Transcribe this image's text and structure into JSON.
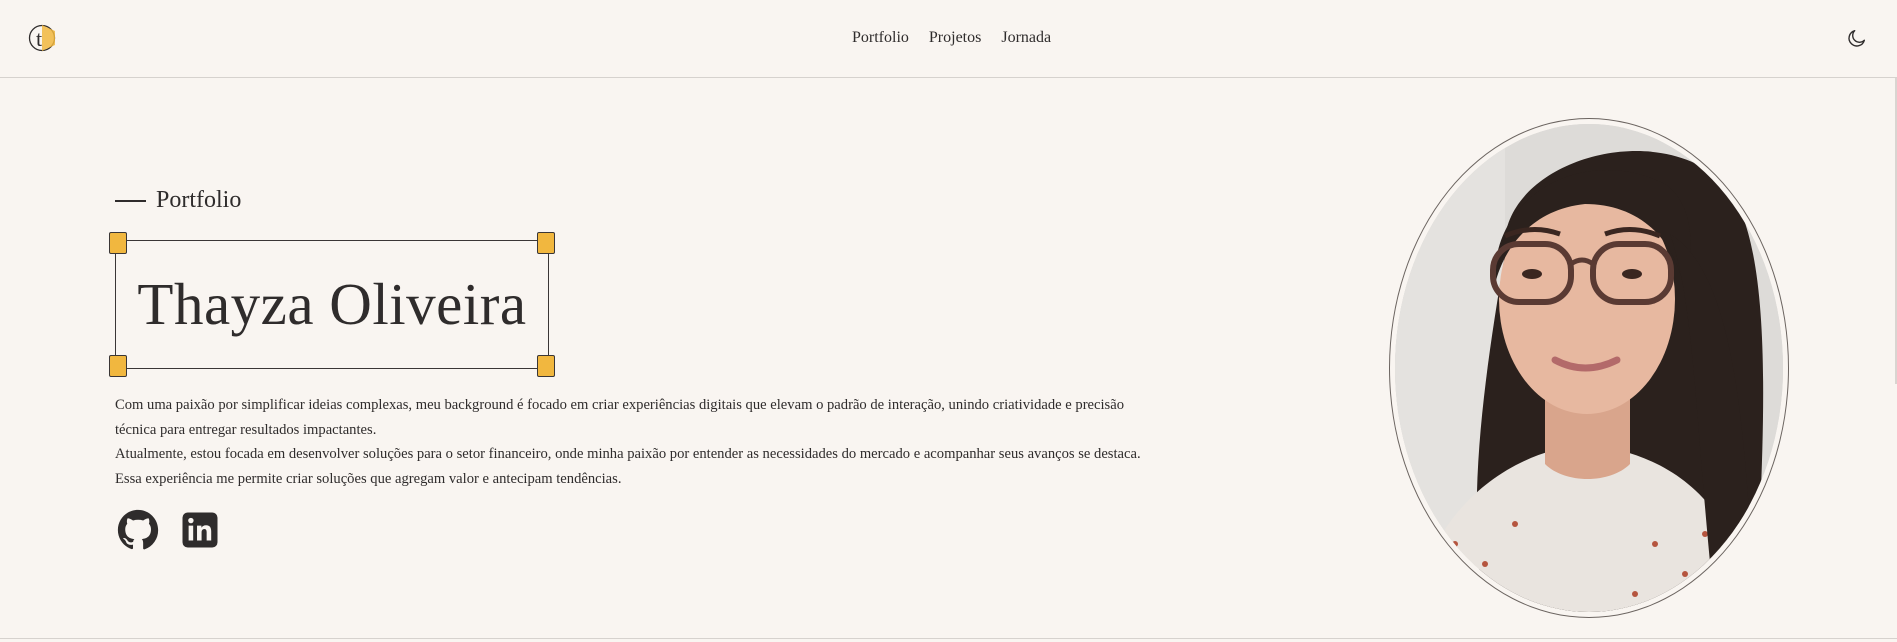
{
  "header": {
    "logo_icon": "t-logo-icon",
    "nav": [
      {
        "label": "Portfolio"
      },
      {
        "label": "Projetos"
      },
      {
        "label": "Jornada"
      }
    ],
    "theme_toggle_icon": "moon-icon"
  },
  "hero": {
    "eyebrow": "Portfolio",
    "name": "Thayza Oliveira",
    "bio_lines": [
      "Com uma paixão por simplificar ideias complexas, meu background é focado em criar experiências digitais que elevam o padrão de interação, unindo criatividade e precisão",
      "técnica para entregar resultados impactantes.",
      "Atualmente, estou focada em desenvolver soluções para o setor financeiro, onde minha paixão por entender as necessidades do mercado e acompanhar seus avanços se destaca.",
      "Essa experiência me permite criar soluções que agregam valor e antecipam tendências."
    ],
    "socials": [
      {
        "icon": "github-icon"
      },
      {
        "icon": "linkedin-icon"
      }
    ]
  },
  "colors": {
    "background": "#f9f5f1",
    "text": "#2f2c2c",
    "accent": "#f1b73f"
  }
}
